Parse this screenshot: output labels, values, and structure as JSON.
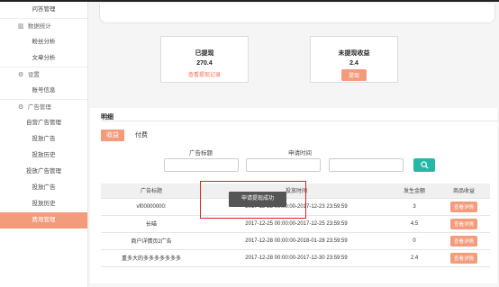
{
  "sidebar": {
    "items": [
      {
        "label": "问答管理",
        "type": "item"
      },
      {
        "label": "数据统计",
        "type": "group",
        "icon": "bar-chart-icon",
        "glyph": "▥"
      },
      {
        "label": "粉丝分析",
        "type": "item"
      },
      {
        "label": "文章分析",
        "type": "item"
      },
      {
        "label": "设置",
        "type": "group",
        "icon": "gear-icon",
        "glyph": "⚙"
      },
      {
        "label": "账号信息",
        "type": "item"
      },
      {
        "label": "广告管理",
        "type": "group",
        "icon": "gear-icon",
        "glyph": "⚙"
      },
      {
        "label": "自营广告管理",
        "type": "item"
      },
      {
        "label": "投放广告",
        "type": "item"
      },
      {
        "label": "投放历史",
        "type": "item"
      },
      {
        "label": "投放广告管理",
        "type": "item"
      },
      {
        "label": "投放广告",
        "type": "item"
      },
      {
        "label": "投放历史",
        "type": "item"
      },
      {
        "label": "费用管理",
        "type": "item",
        "active": true
      }
    ]
  },
  "stats": {
    "withdrawn": {
      "title": "已提现",
      "value": "270.4",
      "link": "查看提现记录"
    },
    "unwithdrawn": {
      "title": "未提现收益",
      "value": "2.4",
      "button": "提现"
    }
  },
  "detail": {
    "title": "明细",
    "tabs": [
      {
        "label": "收益",
        "active": true
      },
      {
        "label": "付费",
        "active": false
      }
    ],
    "filters": {
      "ad_title_label": "广告标题",
      "apply_time_label": "申请时间"
    },
    "search_icon": "search-icon"
  },
  "table": {
    "headers": [
      "广告标题",
      "投放时间",
      "发生金额",
      "商品收益"
    ],
    "rows": [
      {
        "title": "vf00000000:",
        "time": "2017-12-23 00:00:00-2017-12-23 23:59:59",
        "amount": "3",
        "action": "查看详情"
      },
      {
        "title": "长喵",
        "time": "2017-12-25 00:00:00-2017-12-25 23:59:59",
        "amount": "4.5",
        "action": "查看详情"
      },
      {
        "title": "商户详情页2广告",
        "time": "2017-12-28 00:00:00-2018-01-28 23:59:59",
        "amount": "0",
        "action": "查看详情"
      },
      {
        "title": "重多大的多多多多多多多",
        "time": "2017-12-28 00:00:00-2017-12-30 23:59:59",
        "amount": "2.4",
        "action": "查看详情"
      }
    ]
  },
  "toast": {
    "message": "申请提现成功"
  },
  "colors": {
    "accent": "#f49b7b",
    "teal": "#26b7a6",
    "highlight": "#e02020"
  }
}
